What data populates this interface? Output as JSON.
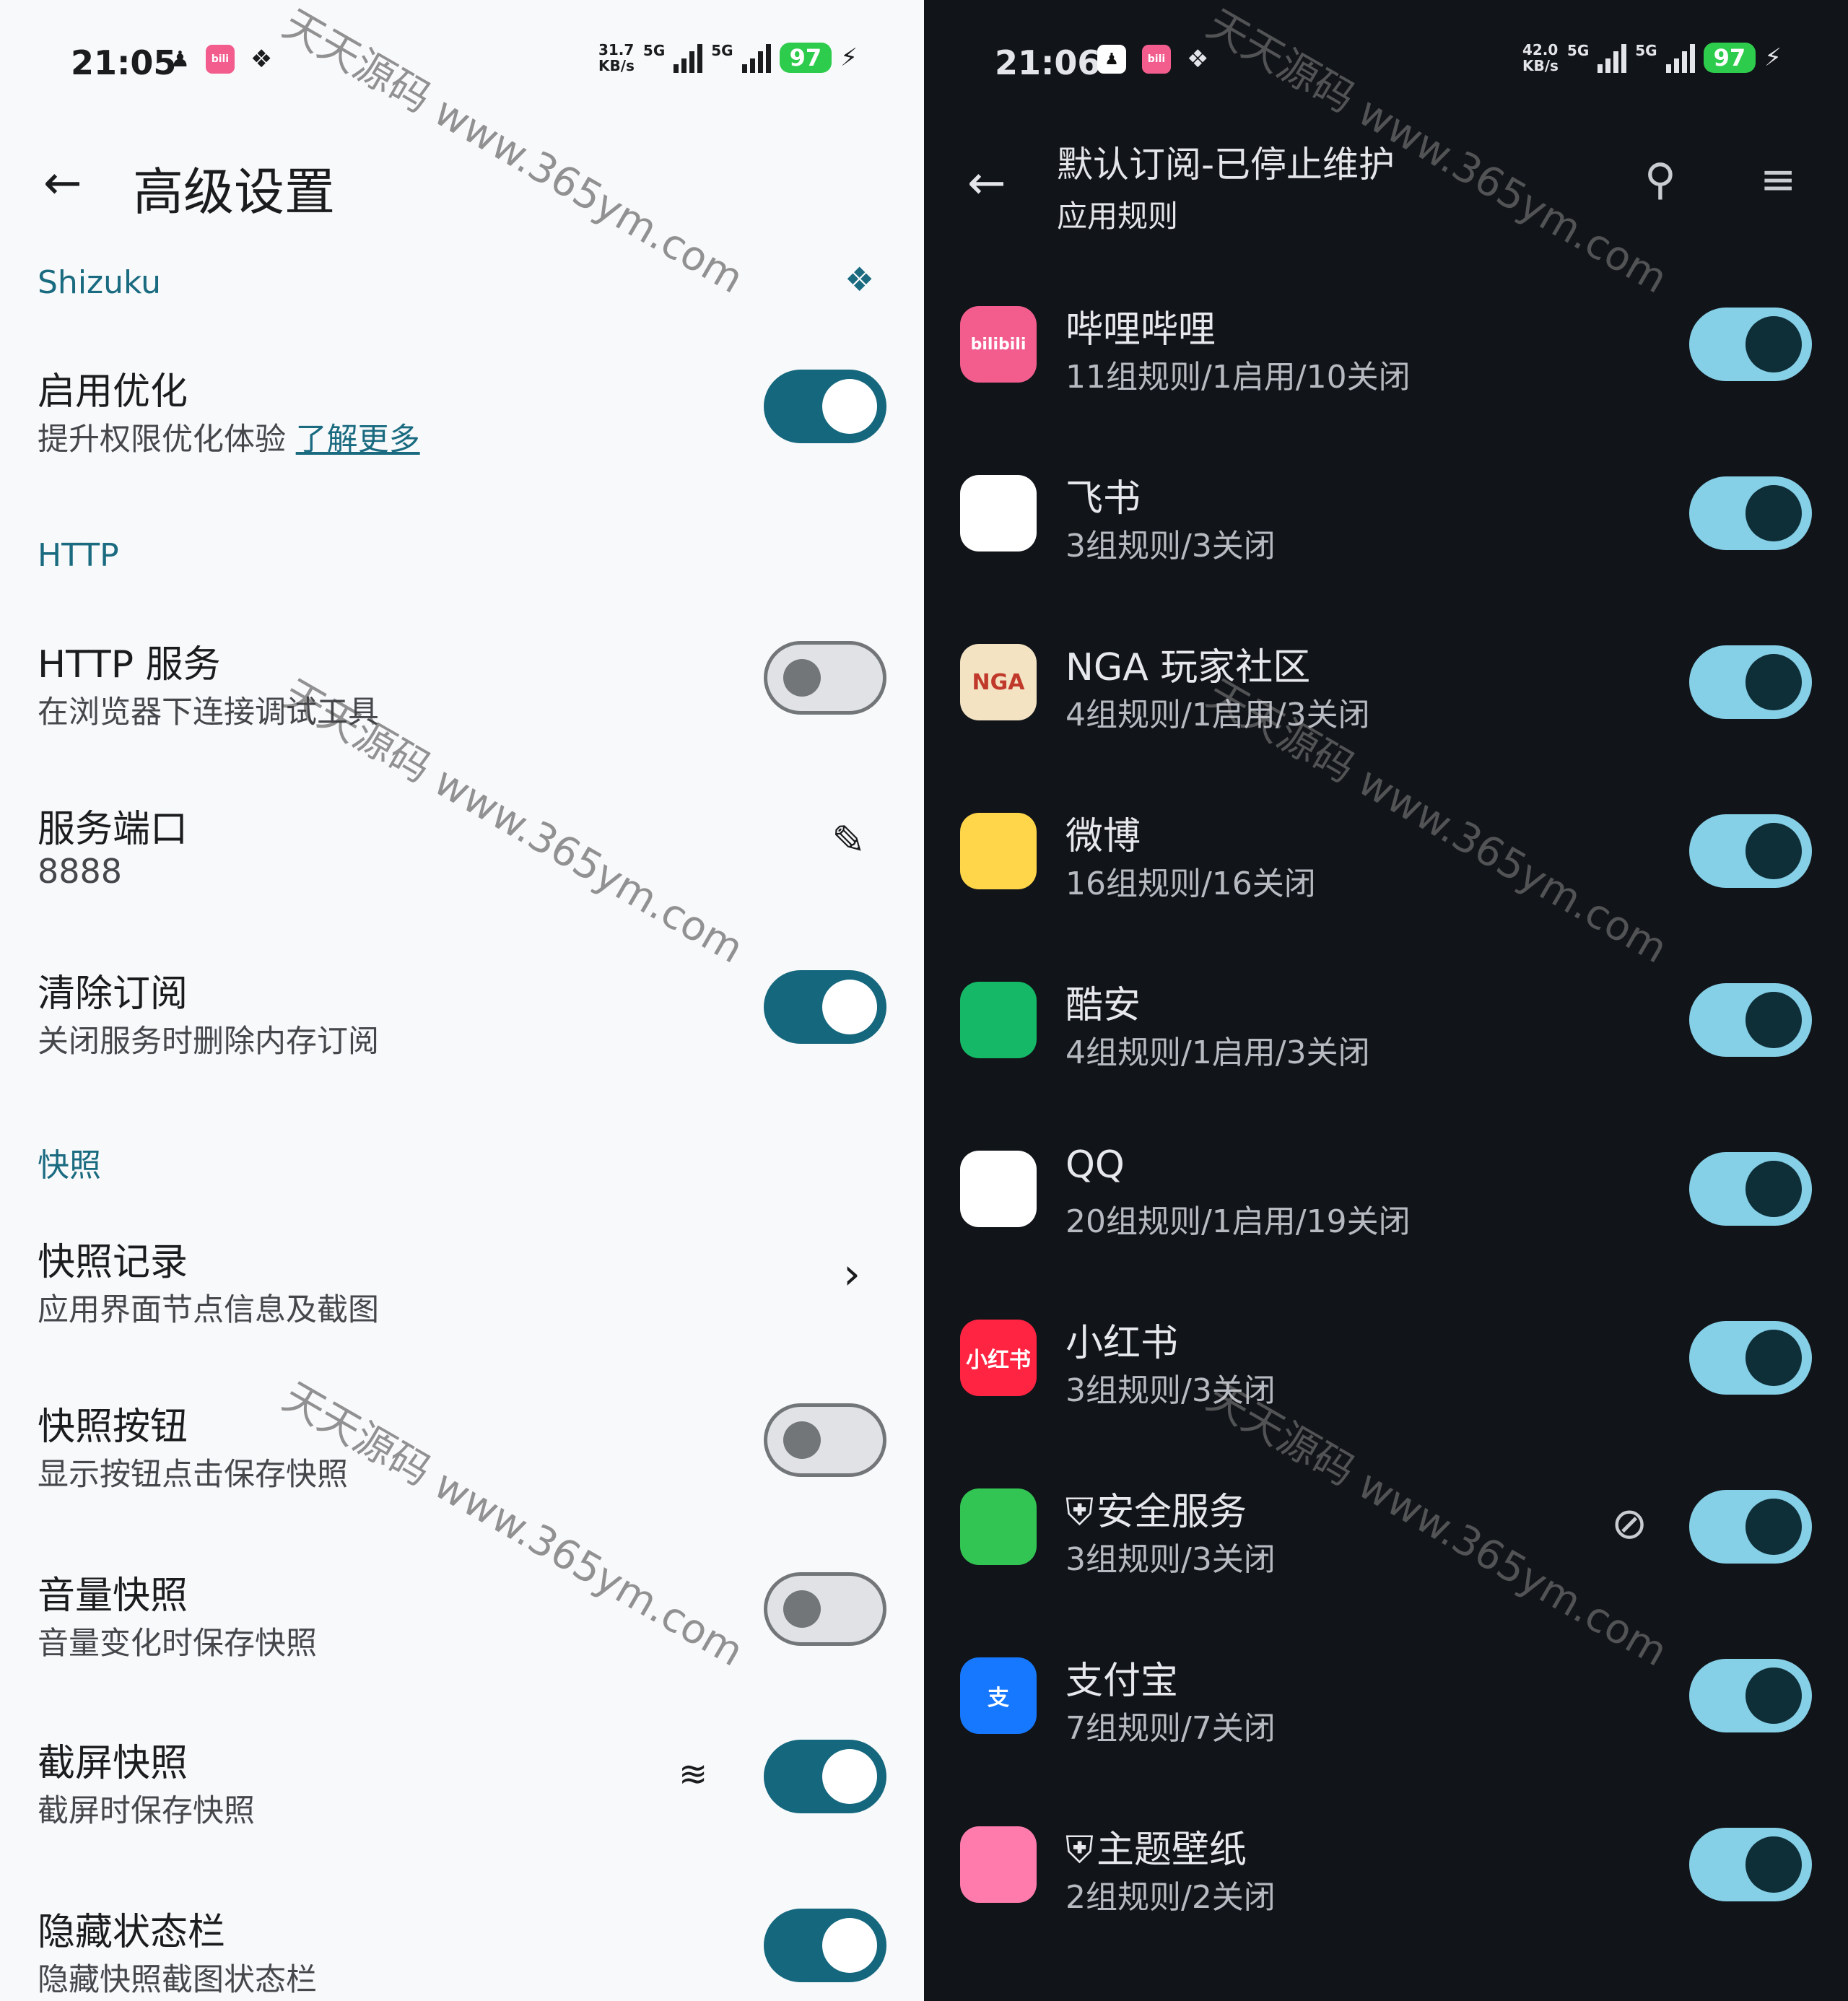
{
  "left": {
    "status": {
      "time": "21:05",
      "speed_top": "31.7",
      "speed_bottom": "KB/s",
      "net1": "5G",
      "net2": "5G",
      "battery": "97"
    },
    "title": "高级设置",
    "sections": {
      "shizuku": "Shizuku",
      "http": "HTTP",
      "snapshot": "快照"
    },
    "rows": [
      {
        "title": "启用优化",
        "sub": "提升权限优化体验",
        "link": "了解更多",
        "toggle": true
      },
      {
        "title": "HTTP 服务",
        "sub": "在浏览器下连接调试工具",
        "toggle": false
      },
      {
        "title": "服务端口",
        "sub": "8888"
      },
      {
        "title": "清除订阅",
        "sub": "关闭服务时删除内存订阅",
        "toggle": true
      },
      {
        "title": "快照记录",
        "sub": "应用界面节点信息及截图"
      },
      {
        "title": "快照按钮",
        "sub": "显示按钮点击保存快照",
        "toggle": false
      },
      {
        "title": "音量快照",
        "sub": "音量变化时保存快照",
        "toggle": false
      },
      {
        "title": "截屏快照",
        "sub": "截屏时保存快照",
        "toggle": true
      },
      {
        "title": "隐藏状态栏",
        "sub": "隐藏快照截图状态栏",
        "toggle": true
      }
    ],
    "watermark": "天天源码 www.365ym.com"
  },
  "right": {
    "status": {
      "time": "21:06",
      "speed_top": "42.0",
      "speed_bottom": "KB/s",
      "net1": "5G",
      "net2": "5G",
      "battery": "97"
    },
    "title": "默认订阅-已停止维护",
    "subtitle": "应用规则",
    "apps": [
      {
        "name": "哔哩哔哩",
        "rules": "11组规则/1启用/10关闭",
        "icon": "bilibili-icon",
        "icon_text": "bilibili",
        "color": "#f25d8e",
        "enabled": true
      },
      {
        "name": "飞书",
        "rules": "3组规则/3关闭",
        "icon": "feishu-icon",
        "icon_text": "",
        "color": "#ffffff",
        "enabled": true
      },
      {
        "name": "NGA 玩家社区",
        "rules": "4组规则/1启用/3关闭",
        "icon": "nga-icon",
        "icon_text": "NGA",
        "color": "#f3e3c3",
        "enabled": true
      },
      {
        "name": "微博",
        "rules": "16组规则/16关闭",
        "icon": "weibo-icon",
        "icon_text": "",
        "color": "#ffd54a",
        "enabled": true
      },
      {
        "name": "酷安",
        "rules": "4组规则/1启用/3关闭",
        "icon": "coolapk-icon",
        "icon_text": "",
        "color": "#14b866",
        "enabled": true
      },
      {
        "name": "QQ",
        "rules": "20组规则/1启用/19关闭",
        "icon": "qq-icon",
        "icon_text": "",
        "color": "#ffffff",
        "enabled": true
      },
      {
        "name": "小红书",
        "rules": "3组规则/3关闭",
        "icon": "xiaohongshu-icon",
        "icon_text": "小红书",
        "color": "#ff2442",
        "enabled": true
      },
      {
        "name": "安全服务",
        "rules": "3组规则/3关闭",
        "icon": "security-icon",
        "icon_text": "",
        "color": "#32c553",
        "enabled": true,
        "shield": true,
        "blocked": true
      },
      {
        "name": "支付宝",
        "rules": "7组规则/7关闭",
        "icon": "alipay-icon",
        "icon_text": "支",
        "color": "#1677ff",
        "enabled": true
      },
      {
        "name": "主题壁纸",
        "rules": "2组规则/2关闭",
        "icon": "theme-icon",
        "icon_text": "",
        "color": "#ff7bac",
        "enabled": true,
        "shield": true
      }
    ],
    "watermark": "天天源码 www.365ym.com"
  }
}
